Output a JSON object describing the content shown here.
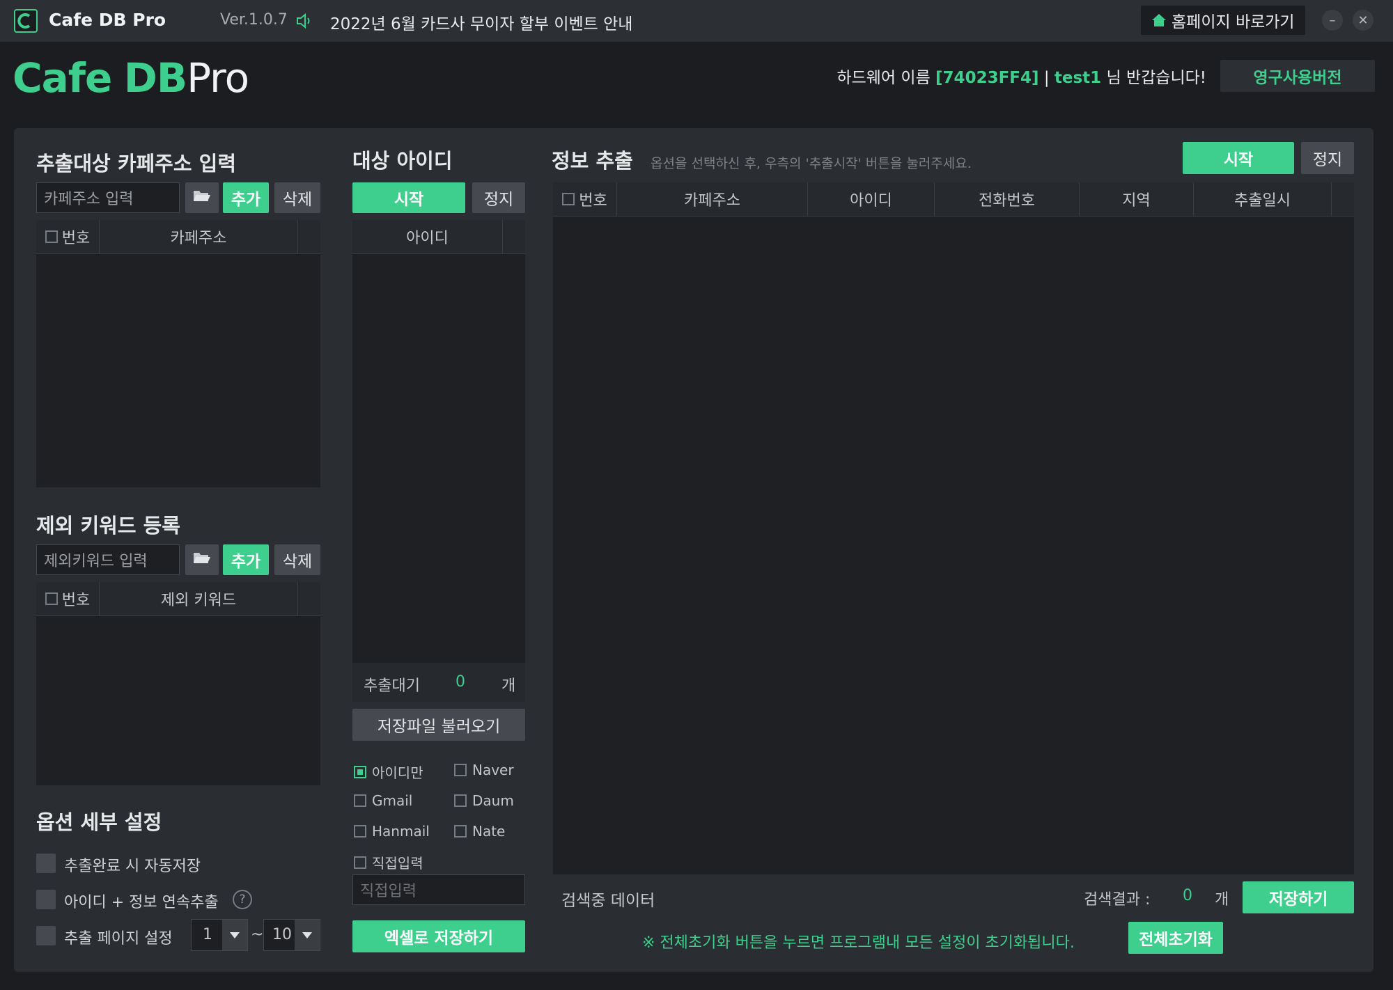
{
  "titlebar": {
    "app_name": "Cafe DB Pro",
    "version": "Ver.1.0.7",
    "notice": "2022년 6월 카드사 무이자 할부 이벤트 안내",
    "homepage_button": "홈페이지 바로가기",
    "minimize": "–",
    "close": "✕"
  },
  "header": {
    "logo_cafe": "Cafe",
    "logo_db": "DB",
    "logo_pro": "Pro",
    "greeting_prefix": "하드웨어 이름",
    "hardware_id": "[74023FF4]",
    "separator": "|",
    "username": "test1",
    "greeting_suffix": "님 반갑습니다!",
    "license_button": "영구사용버전"
  },
  "cafe_section": {
    "title": "추출대상 카페주소 입력",
    "input_placeholder": "카페주소 입력",
    "add_button": "추가",
    "delete_button": "삭제",
    "columns": [
      "번호",
      "카페주소"
    ]
  },
  "keyword_section": {
    "title": "제외 키워드 등록",
    "input_placeholder": "제외키워드 입력",
    "add_button": "추가",
    "delete_button": "삭제",
    "columns": [
      "번호",
      "제외 키워드"
    ]
  },
  "options_section": {
    "title": "옵션 세부 설정",
    "auto_save": "추출완료 시 자동저장",
    "continuous": "아이디 + 정보 연속추출",
    "help": "?",
    "page_setting": "추출 페이지 설정",
    "page_from": "1",
    "page_tilde": "~",
    "page_to": "10"
  },
  "target_ids": {
    "title": "대상 아이디",
    "start_button": "시작",
    "stop_button": "정지",
    "column": "아이디",
    "pending_label": "추출대기",
    "pending_count": "0",
    "pending_unit": "개",
    "load_button": "저장파일 불러오기",
    "checkboxes": [
      {
        "label": "아이디만",
        "checked": true
      },
      {
        "label": "Naver",
        "checked": false
      },
      {
        "label": "Gmail",
        "checked": false
      },
      {
        "label": "Daum",
        "checked": false
      },
      {
        "label": "Hanmail",
        "checked": false
      },
      {
        "label": "Nate",
        "checked": false
      },
      {
        "label": "직접입력",
        "checked": false
      }
    ],
    "direct_input_placeholder": "직접입력",
    "excel_button": "엑셀로 저장하기"
  },
  "extract": {
    "title": "정보 추출",
    "hint": "옵션을 선택하신 후, 우측의 '추출시작' 버튼을 눌러주세요.",
    "start_button": "시작",
    "stop_button": "정지",
    "columns": [
      "번호",
      "카페주소",
      "아이디",
      "전화번호",
      "지역",
      "추출일시"
    ],
    "status": "검색중 데이터",
    "result_label": "검색결과 :",
    "result_count": "0",
    "result_unit": "개",
    "save_button": "저장하기",
    "reset_notice": "※ 전체초기화 버튼을 누르면 프로그램내 모든 설정이 초기화됩니다.",
    "reset_button": "전체초기화"
  },
  "colors": {
    "accent": "#3ecf8e",
    "background": "#1b1d20",
    "panel": "#2a2d31"
  }
}
